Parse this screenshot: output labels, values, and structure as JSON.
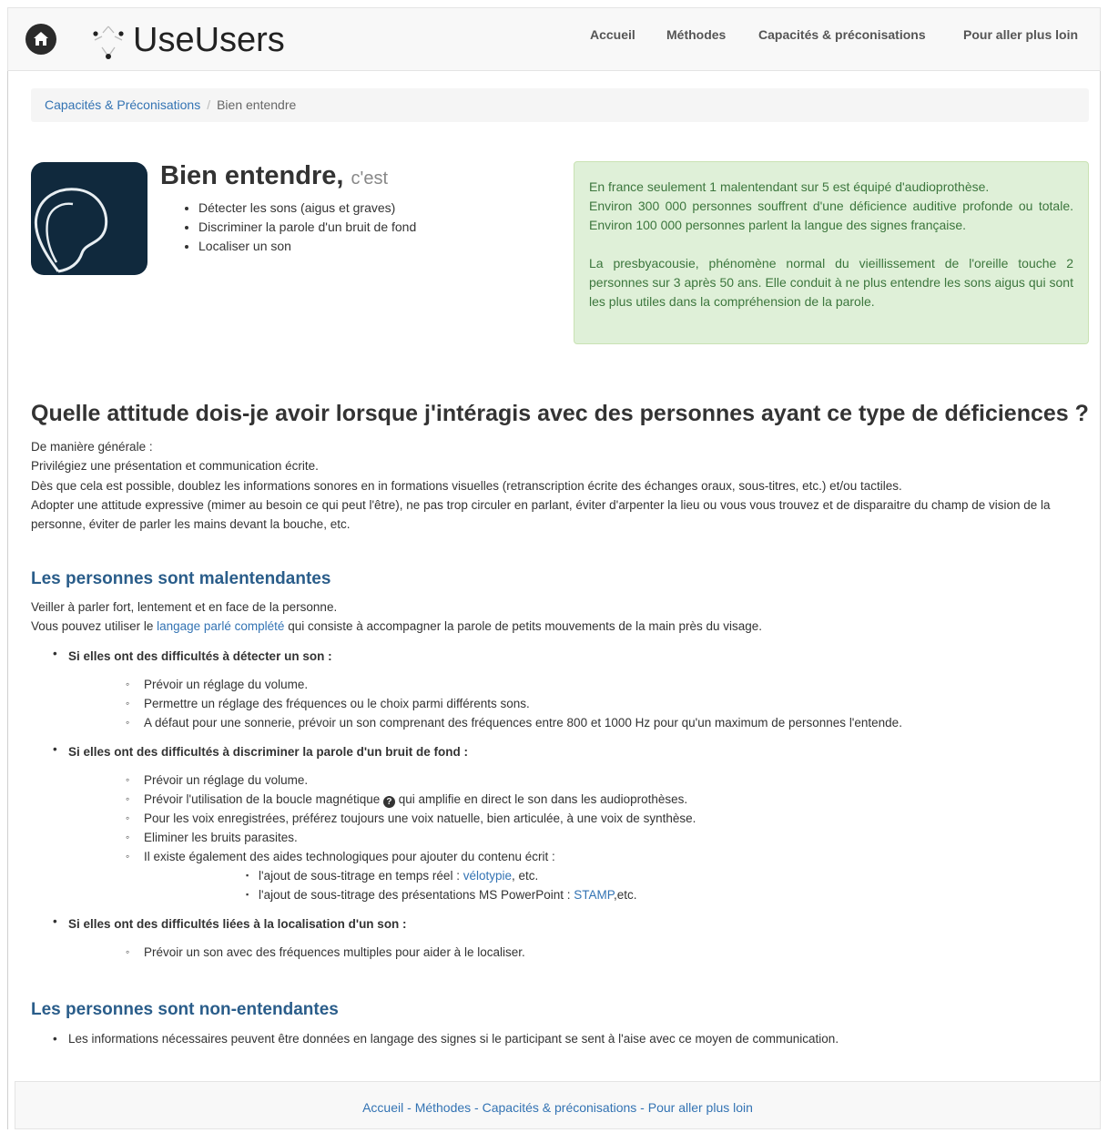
{
  "nav": {
    "brand": "UseUsers",
    "links": [
      "Accueil",
      "Méthodes",
      "Capacités & préconisations",
      "Pour aller plus loin"
    ]
  },
  "breadcrumb": {
    "parent": "Capacités & Préconisations",
    "current": "Bien entendre"
  },
  "hero": {
    "title": "Bien entendre,",
    "subtitle": "c'est",
    "items": [
      "Détecter les sons (aigus et graves)",
      "Discriminer la parole d'un bruit de fond",
      "Localiser un son"
    ]
  },
  "alert": {
    "p1_line1": "En france seulement 1 malentendant sur 5 est équipé d'audioprothèse.",
    "p1_line2": "Environ 300 000 personnes souffrent d'une déficience auditive profonde ou totale. Environ 100 000 personnes parlent la langue des signes française.",
    "p2": "La presbyacousie, phénomène normal du vieillissement de l'oreille touche 2 personnes sur 3 après 50 ans. Elle conduit à ne plus entendre les sons aigus qui sont les plus utiles dans la compréhension de la parole."
  },
  "main": {
    "heading": "Quelle attitude dois-je avoir lorsque j'intéragis avec des personnes ayant ce type de déficiences ?",
    "general": [
      "De manière générale :",
      "Privilégiez une présentation et communication écrite.",
      "Dès que cela est possible, doublez les informations sonores en in formations visuelles (retranscription écrite des échanges oraux, sous-titres, etc.) et/ou tactiles.",
      "Adopter une attitude expressive (mimer au besoin ce qui peut l'être), ne pas trop circuler en parlant, éviter d'arpenter la lieu ou vous vous trouvez et de disparaitre du champ de vision de la personne, éviter de parler les mains devant la bouche, etc."
    ]
  },
  "malentendantes": {
    "heading": "Les personnes sont malentendantes",
    "intro1": "Veiller à parler fort, lentement et en face de la personne.",
    "intro2_pre": "Vous pouvez utiliser le ",
    "intro2_link": "langage parlé complété",
    "intro2_post": " qui consiste à accompagner la parole de petits mouvements de la main près du visage.",
    "group1": {
      "title": "Si elles ont des difficultés à détecter un son :",
      "items": [
        "Prévoir un réglage du volume.",
        "Permettre un réglage des fréquences ou le choix parmi différents sons.",
        "A défaut pour une sonnerie, prévoir un son comprenant des fréquences entre 800 et 1000 Hz pour qu'un maximum de personnes l'entende."
      ]
    },
    "group2": {
      "title": "Si elles ont des difficultés à discriminer la parole d'un bruit de fond :",
      "item1": "Prévoir un réglage du volume.",
      "item2_pre": "Prévoir l'utilisation de la boucle magnétique ",
      "item2_post": " qui amplifie en direct le son dans les audioprothèses.",
      "item3": "Pour les voix enregistrées, préférez toujours une voix natuelle, bien articulée, à une voix de synthèse.",
      "item4": "Eliminer les bruits parasites.",
      "item5": "Il existe également des aides technologiques pour ajouter du contenu écrit :",
      "sub1_pre": "l'ajout de sous-titrage en temps réel : ",
      "sub1_link": "vélotypie",
      "sub1_post": ", etc.",
      "sub2_pre": "l'ajout de sous-titrage des présentations MS PowerPoint : ",
      "sub2_link": "STAMP",
      "sub2_post": ",etc."
    },
    "group3": {
      "title": "Si elles ont des difficultés liées à la localisation d'un son :",
      "items": [
        "Prévoir un son avec des fréquences multiples pour aider à le localiser."
      ]
    }
  },
  "nonentendantes": {
    "heading": "Les personnes sont non-entendantes",
    "item": "Les informations nécessaires peuvent être données en langage des signes si le participant se sent à l'aise avec ce moyen de communication."
  },
  "footer": {
    "links": [
      "Accueil",
      "Méthodes",
      "Capacités & préconisations",
      "Pour aller plus loin"
    ],
    "separator": " - "
  }
}
